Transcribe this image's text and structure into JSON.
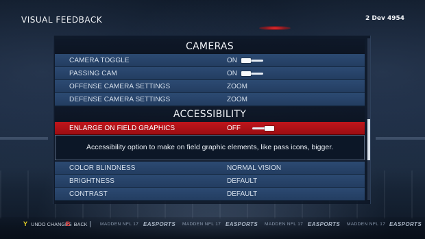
{
  "header": {
    "title": "VISUAL FEEDBACK",
    "date": "2 Dev 4954"
  },
  "sections": [
    {
      "title": "CAMERAS",
      "rows": [
        {
          "label": "CAMERA TOGGLE",
          "value": "ON",
          "toggle": true
        },
        {
          "label": "PASSING CAM",
          "value": "ON",
          "toggle": true
        },
        {
          "label": "OFFENSE CAMERA SETTINGS",
          "value": "ZOOM",
          "toggle": false
        },
        {
          "label": "DEFENSE CAMERA SETTINGS",
          "value": "ZOOM",
          "toggle": false
        }
      ]
    },
    {
      "title": "ACCESSIBILITY",
      "rows": [
        {
          "label": "ENLARGE ON FIELD GRAPHICS",
          "value": "OFF",
          "toggle": true,
          "selected": true
        },
        {
          "label": "COLOR BLINDNESS",
          "value": "NORMAL VISION",
          "toggle": false
        },
        {
          "label": "BRIGHTNESS",
          "value": "DEFAULT",
          "toggle": false
        },
        {
          "label": "CONTRAST",
          "value": "DEFAULT",
          "toggle": false
        }
      ]
    }
  ],
  "tooltip": "Accessibility option to make on field graphic elements, like pass icons, bigger.",
  "footer": {
    "hints": [
      {
        "key": "Y",
        "label": "UNDO CHANGES"
      },
      {
        "key": "B",
        "label": "BACK"
      }
    ],
    "brand": {
      "game": "MADDEN NFL 17",
      "publisher": "EASPORTS"
    }
  },
  "colors": {
    "row_bg": "#2c4a72",
    "selected_bg": "#c0151b",
    "key_y": "#e8d226",
    "key_b": "#e23a3a"
  },
  "icons": [
    "y-button-icon",
    "b-button-icon",
    "toggle-switch-icon"
  ]
}
